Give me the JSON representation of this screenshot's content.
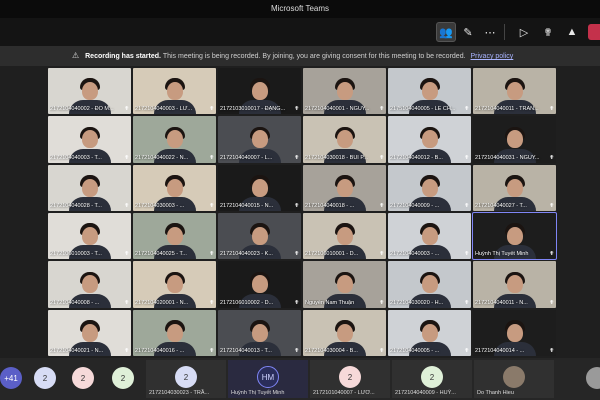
{
  "window": {
    "title": "Microsoft Teams"
  },
  "colors": {
    "accent": "#7f85f5",
    "leave": "#c4314b",
    "banner_bg": "#2d2d2d"
  },
  "toolbar": {
    "icons": [
      "people-icon",
      "chat-icon",
      "more-icon",
      "camera-icon",
      "mic-off-icon",
      "share-icon",
      "leave-icon"
    ]
  },
  "banner": {
    "title": "Recording has started.",
    "message": "This meeting is being recorded. By joining, you are giving consent for this meeting to be recorded.",
    "link": "Privacy policy"
  },
  "participants": [
    "2172104040002 - ĐỖ M...",
    "2172104040003 - LƯ...",
    "2172103010017 - ĐẶNG...",
    "2172104040001 - NGUY...",
    "2175104040005 - LÊ CH...",
    "2172104040011 - TRẦN...",
    "2172104040003 - T...",
    "2172104040022 - N...",
    "2172104040007 - L...",
    "2172104030018 - BÙI P...",
    "2172104040012 - B...",
    "2172104040031 - NGUY...",
    "2172104040028 - T...",
    "2172104030003 - ...",
    "2172104040015 - N...",
    "2172104040018 - ...",
    "2172104040009 - ...",
    "2172104040027 - T...",
    "2172106010003 - T...",
    "2172104040025 - T...",
    "2172104040023 - K...",
    "2172106010001 - D...",
    "2172104040003 - ...",
    "Huỳnh Thị Tuyết Minh",
    "2172104040008 - ...",
    "2172104020001 - N...",
    "2172106010002 - D...",
    "Nguyễn Nam Thuận",
    "2172104030020 - H...",
    "2172104040011 - N...",
    "2172104040021 - N...",
    "2172104040016 - ...",
    "2172104040013 - T...",
    "2172104030004 - B...",
    "2172104040005 - ...",
    "2172104040014 - ..."
  ],
  "tray": {
    "overflow": "+41",
    "counts": [
      "2",
      "2",
      "2",
      "2",
      "2",
      "2"
    ],
    "cards": [
      {
        "name": "2172104030023 - TRẦ...",
        "initials": "2"
      },
      {
        "name": "Huỳnh Thị Tuyết Minh",
        "initials": "HM"
      },
      {
        "name": "2172101040007 - LƯƠ...",
        "initials": "2"
      },
      {
        "name": "2172104040009 - HUỲ...",
        "initials": "2"
      },
      {
        "name": "Do Thanh Hieu",
        "initials": ""
      }
    ]
  }
}
